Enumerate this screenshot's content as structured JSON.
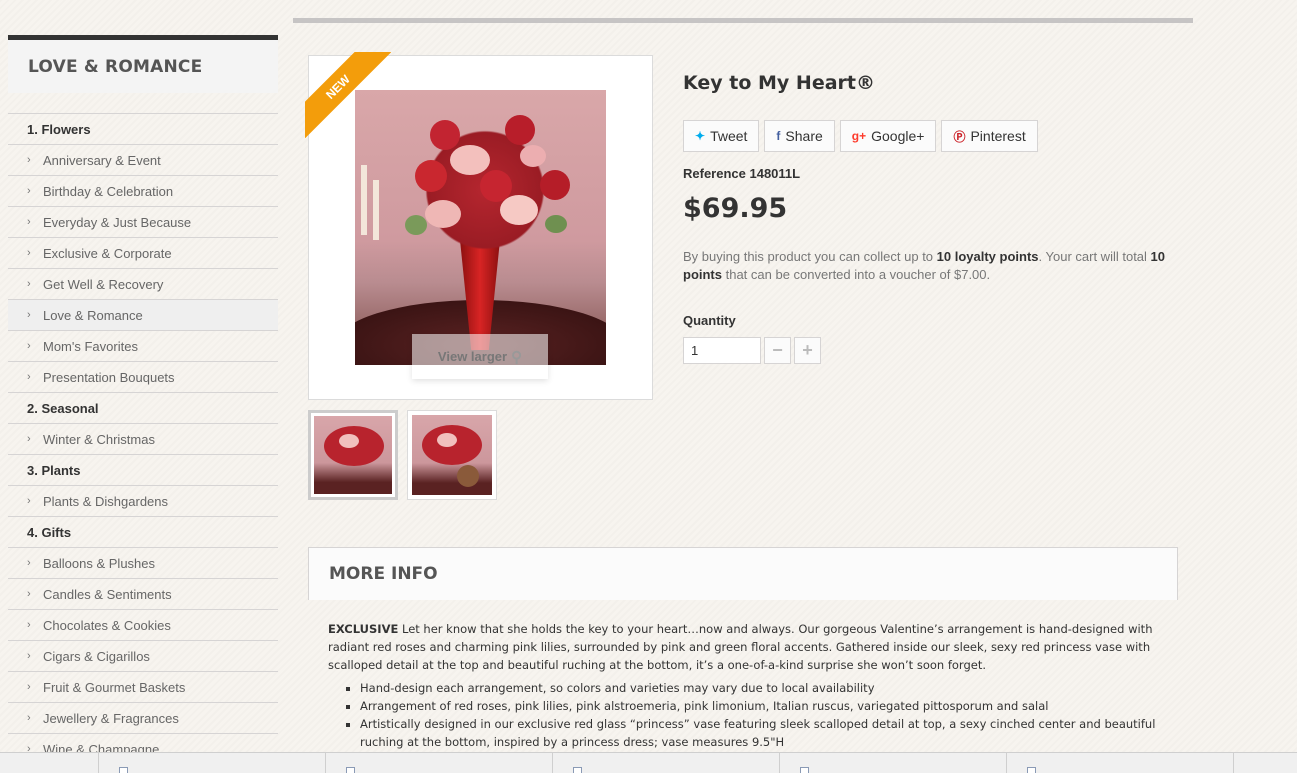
{
  "sidebar": {
    "title": "LOVE & ROMANCE",
    "categories": [
      {
        "label": "1. Flowers",
        "type": "group"
      },
      {
        "label": "Anniversary & Event",
        "type": "sub"
      },
      {
        "label": "Birthday & Celebration",
        "type": "sub"
      },
      {
        "label": "Everyday & Just Because",
        "type": "sub"
      },
      {
        "label": "Exclusive & Corporate",
        "type": "sub"
      },
      {
        "label": "Get Well & Recovery",
        "type": "sub"
      },
      {
        "label": "Love & Romance",
        "type": "sub",
        "active": true
      },
      {
        "label": "Mom's Favorites",
        "type": "sub"
      },
      {
        "label": "Presentation Bouquets",
        "type": "sub"
      },
      {
        "label": "2. Seasonal",
        "type": "group"
      },
      {
        "label": "Winter & Christmas",
        "type": "sub"
      },
      {
        "label": "3. Plants",
        "type": "group"
      },
      {
        "label": "Plants & Dishgardens",
        "type": "sub"
      },
      {
        "label": "4. Gifts",
        "type": "group"
      },
      {
        "label": "Balloons & Plushes",
        "type": "sub"
      },
      {
        "label": "Candles & Sentiments",
        "type": "sub"
      },
      {
        "label": "Chocolates & Cookies",
        "type": "sub"
      },
      {
        "label": "Cigars & Cigarillos",
        "type": "sub"
      },
      {
        "label": "Fruit & Gourmet Baskets",
        "type": "sub"
      },
      {
        "label": "Jewellery & Fragrances",
        "type": "sub"
      },
      {
        "label": "Wine & Champagne",
        "type": "sub"
      }
    ]
  },
  "product": {
    "badge": "NEW",
    "view_larger": "View larger",
    "name": "Key to My Heart®",
    "share": {
      "tweet": "Tweet",
      "facebook": "Share",
      "google": "Google+",
      "pinterest": "Pinterest"
    },
    "reference": "Reference 148011L",
    "price": "$69.95",
    "loyalty": {
      "pre": "By buying this product you can collect up to ",
      "points": "10 loyalty points",
      "mid": ". Your cart will total ",
      "total": "10 points",
      "post": " that can be converted into a voucher of $7.00."
    },
    "quantity_label": "Quantity",
    "quantity_value": "1"
  },
  "more_info": {
    "heading": "MORE INFO",
    "lead_bold": "EXCLUSIVE",
    "lead_text": " Let her know that she holds the key to your heart…now and always. Our gorgeous Valentine’s arrangement is hand-designed with radiant red roses and charming pink lilies, surrounded by pink and green floral accents. Gathered inside our sleek, sexy red princess vase with scalloped detail at the top and beautiful ruching at the bottom, it’s a one-of-a-kind surprise she won’t soon forget.",
    "bullets": [
      "Hand-design each arrangement, so colors and varieties may vary due to local availability",
      "Arrangement of red roses, pink lilies, pink alstroemeria, pink limonium, Italian ruscus, variegated pittosporum and salal",
      "Artistically designed in our exclusive red glass “princess” vase featuring sleek scalloped detail at top, a sexy cinched center and beautiful ruching at the bottom, inspired by a princess dress; vase measures 9.5\"H"
    ]
  },
  "colors": {
    "ribbon": "#f39d0b",
    "pinterest": "#cb2027",
    "twitter": "#00aced",
    "facebook": "#435f9f",
    "google": "#fd3a2b"
  }
}
